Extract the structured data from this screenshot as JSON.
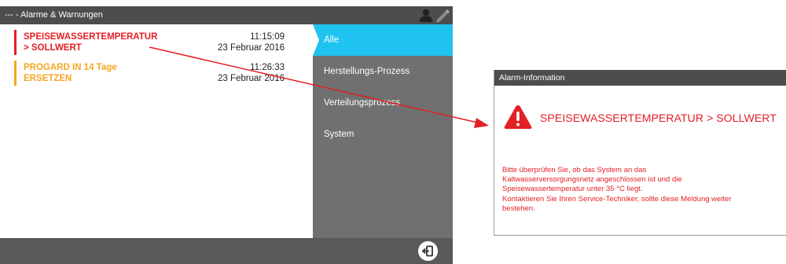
{
  "panel": {
    "title": "--- - Alarme & Warnungen",
    "icons": [
      "user-icon",
      "pen-icon",
      "exit-icon"
    ]
  },
  "alarms": [
    {
      "line1": "SPEISEWASSERTEMPERATUR",
      "line2": "> SOLLWERT",
      "time": "11:15:09",
      "date": "23 Februar 2016",
      "color": "#e31e24"
    },
    {
      "line1": "PROGARD IN 14 Tage",
      "line2": "ERSETZEN",
      "time": "11:26:33",
      "date": "23 Februar 2016",
      "color": "#f5a623"
    }
  ],
  "menu": {
    "items": [
      {
        "label": "Alle",
        "active": true
      },
      {
        "label": "Herstellungs-Prozess",
        "active": false
      },
      {
        "label": "Verteilungsprozess",
        "active": false
      },
      {
        "label": "System",
        "active": false
      }
    ],
    "active_color": "#1ec3f0"
  },
  "dialog": {
    "title": "Alarm-Information",
    "alarm_name": "SPEISEWASSERTEMPERATUR > SOLLWERT",
    "icon": "warning-icon",
    "message_lines": [
      "Bitte überprüfen Sie, ob das System an das",
      "Kaltwasserversorgungsnetz angeschlossen ist und die",
      "Speisewassertemperatur unter 35 °C liegt.",
      "Kontaktieren Sie Ihren Service-Techniker, sollte diese Meldung weiter",
      "bestehen."
    ]
  },
  "colors": {
    "alarm_red": "#e31e24",
    "warning_orange": "#f5a623",
    "titlebar": "#4d4d4d",
    "menu_bg": "#707070"
  }
}
